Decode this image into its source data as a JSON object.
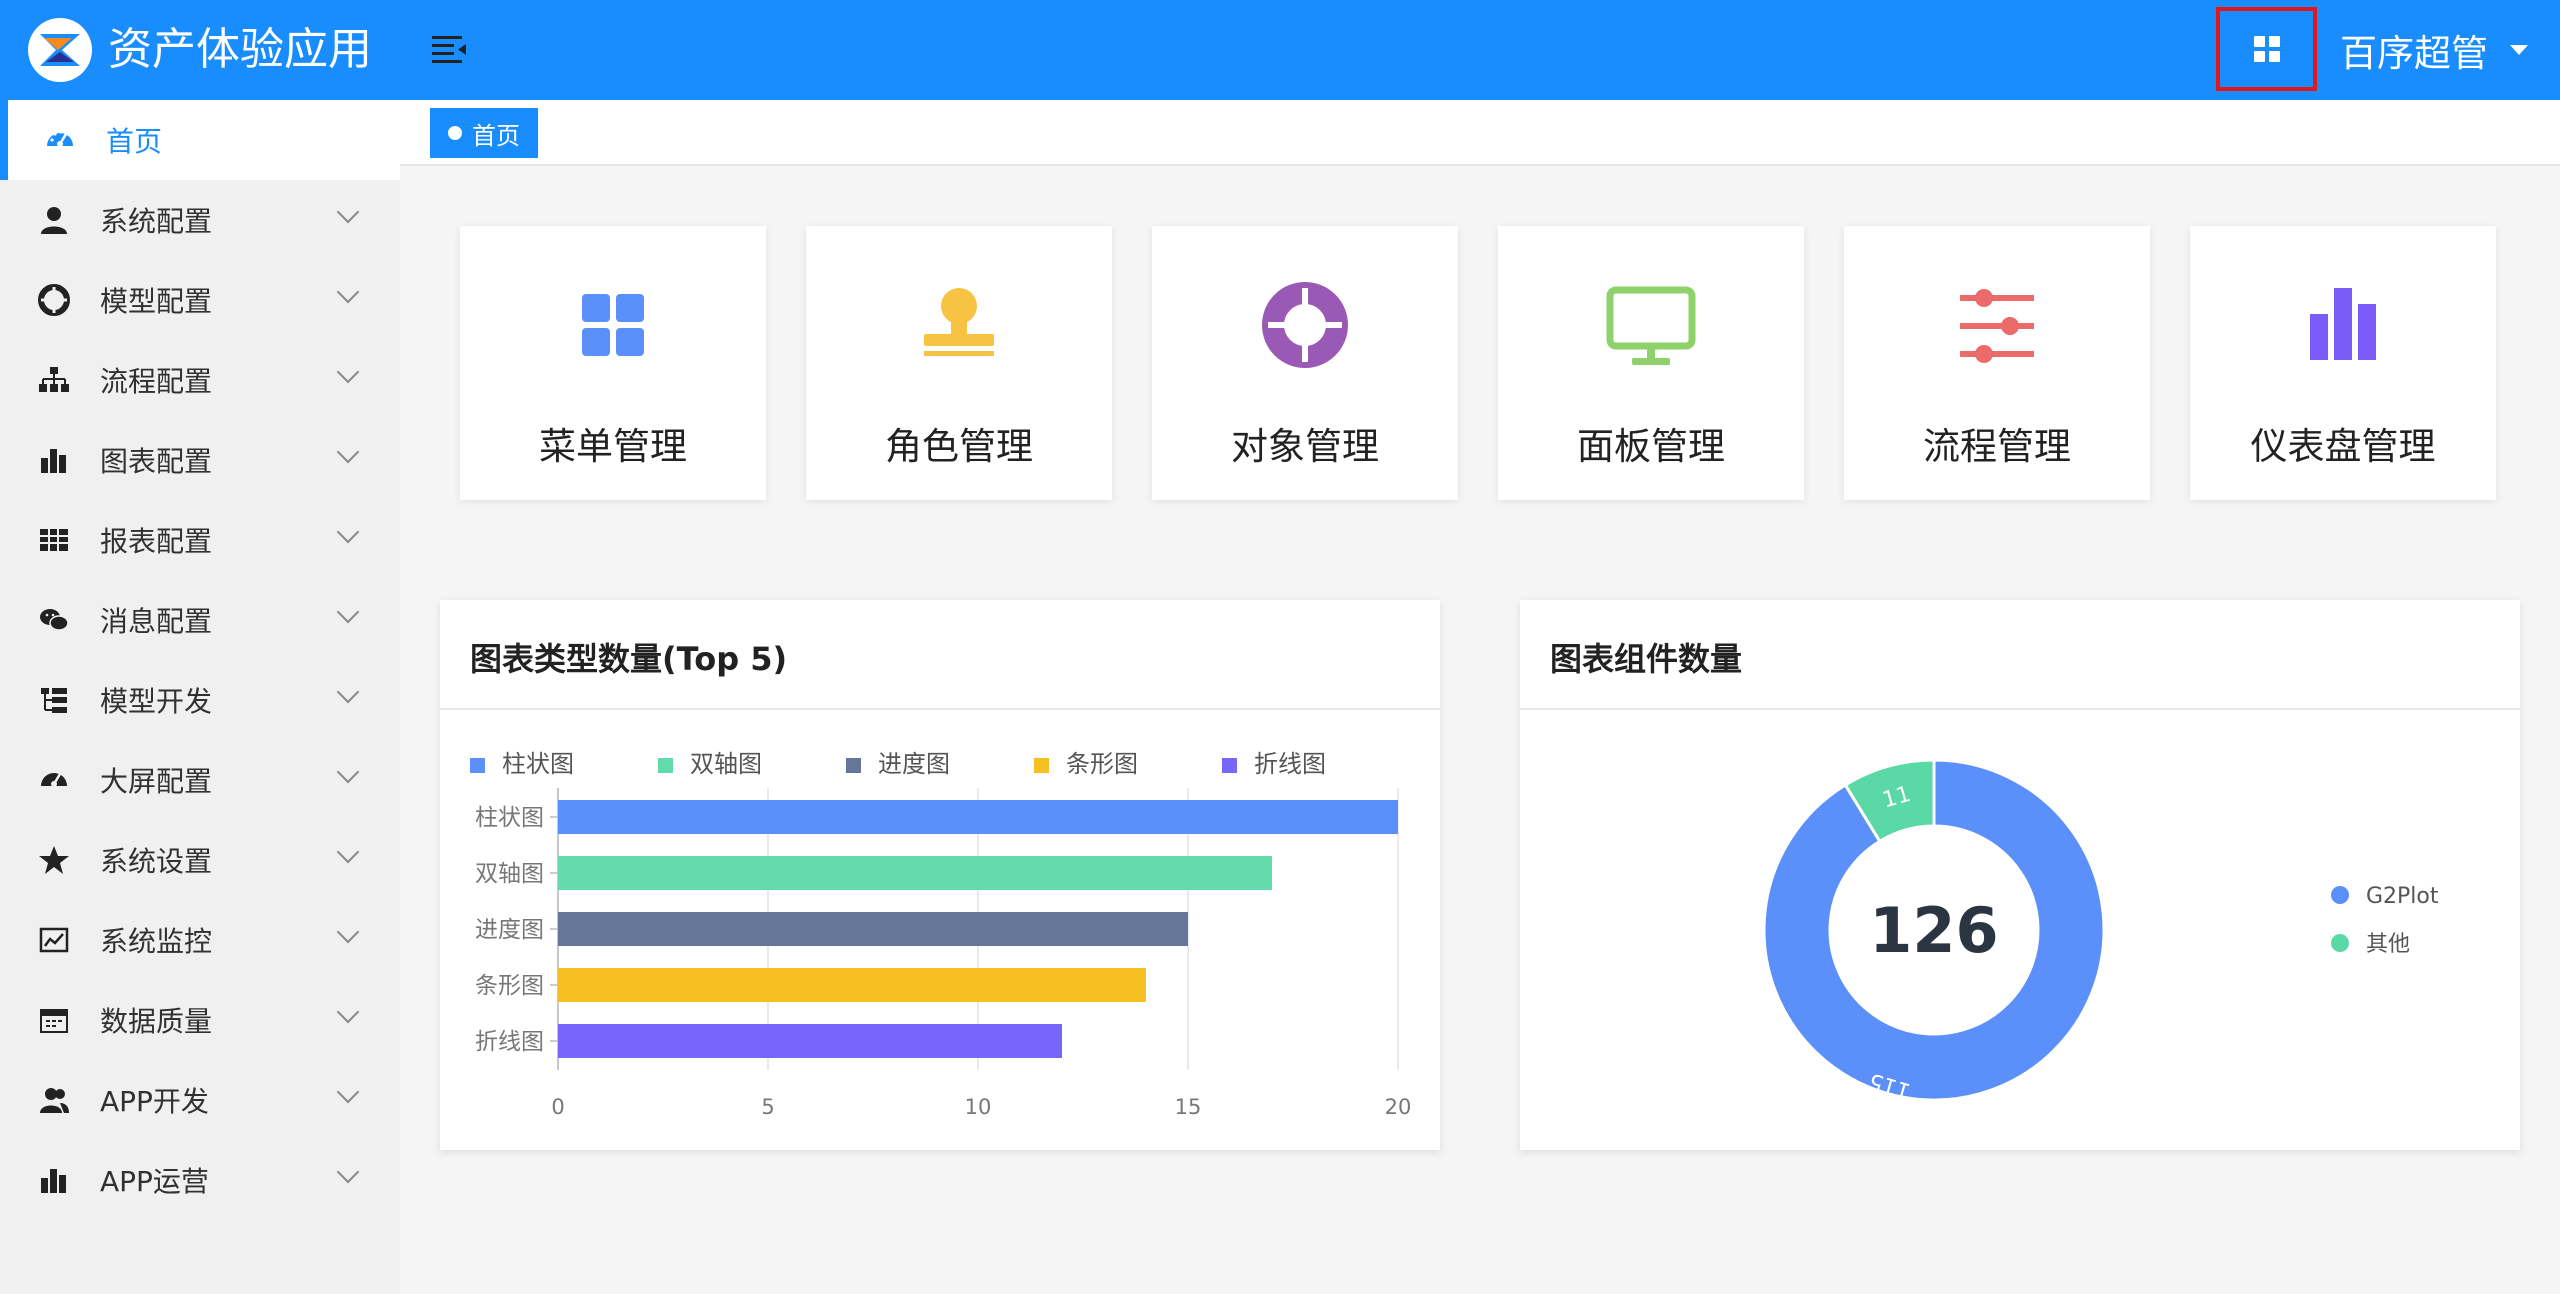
{
  "header": {
    "app_title": "资产体验应用",
    "user_name": "百序超管",
    "brand_color": "#1a8dfe"
  },
  "sidebar": {
    "items": [
      {
        "label": "首页",
        "icon": "dashboard-icon",
        "active": true
      },
      {
        "label": "系统配置",
        "icon": "user-icon"
      },
      {
        "label": "模型配置",
        "icon": "lifebuoy-icon"
      },
      {
        "label": "流程配置",
        "icon": "sitemap-icon"
      },
      {
        "label": "图表配置",
        "icon": "bar-chart-icon"
      },
      {
        "label": "报表配置",
        "icon": "table-icon"
      },
      {
        "label": "消息配置",
        "icon": "chat-icon"
      },
      {
        "label": "模型开发",
        "icon": "tree-icon"
      },
      {
        "label": "大屏配置",
        "icon": "dashboard-icon"
      },
      {
        "label": "系统设置",
        "icon": "star-icon"
      },
      {
        "label": "系统监控",
        "icon": "monitor-chart-icon"
      },
      {
        "label": "数据质量",
        "icon": "calendar-icon"
      },
      {
        "label": "APP开发",
        "icon": "users-icon"
      },
      {
        "label": "APP运营",
        "icon": "bar-chart-icon"
      }
    ]
  },
  "breadcrumb": {
    "tag": "首页"
  },
  "cards": [
    {
      "label": "菜单管理",
      "icon": "grid-icon",
      "color": "#5b8ff9"
    },
    {
      "label": "角色管理",
      "icon": "stamp-icon",
      "color": "#f6c343"
    },
    {
      "label": "对象管理",
      "icon": "lifebuoy-icon",
      "color": "#9b59b6"
    },
    {
      "label": "面板管理",
      "icon": "monitor-icon",
      "color": "#8fd16a"
    },
    {
      "label": "流程管理",
      "icon": "sliders-icon",
      "color": "#eb6b6b"
    },
    {
      "label": "仪表盘管理",
      "icon": "bar-chart-icon",
      "color": "#7a5cf6"
    }
  ],
  "panels": {
    "bar_title": "图表类型数量(Top 5)",
    "donut_title": "图表组件数量"
  },
  "chart_data": [
    {
      "type": "bar",
      "orientation": "horizontal",
      "title": "图表类型数量(Top 5)",
      "categories": [
        "柱状图",
        "双轴图",
        "进度图",
        "条形图",
        "折线图"
      ],
      "values": [
        20,
        17,
        15,
        14,
        12
      ],
      "colors": [
        "#5b8ff9",
        "#62daab",
        "#657798",
        "#f6c022",
        "#7666f9"
      ],
      "legend": [
        "柱状图",
        "双轴图",
        "进度图",
        "条形图",
        "折线图"
      ],
      "legend_position": "top-left",
      "xlim": [
        0,
        20
      ],
      "xticks": [
        0,
        5,
        10,
        15,
        20
      ],
      "grid": true
    },
    {
      "type": "pie",
      "donut": true,
      "title": "图表组件数量",
      "categories": [
        "G2Plot",
        "其他"
      ],
      "values": [
        115,
        11
      ],
      "colors": [
        "#5b8ff9",
        "#5ad8a6"
      ],
      "center_value": "126",
      "legend_position": "right"
    }
  ]
}
